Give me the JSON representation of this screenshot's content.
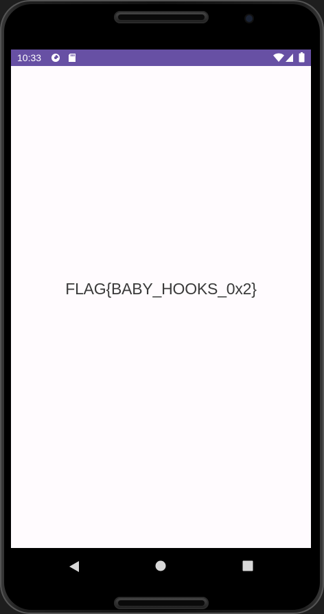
{
  "status_bar": {
    "time": "10:33",
    "background_color": "#6750a4",
    "left_icons": [
      "data-saver-icon",
      "sd-card-icon"
    ],
    "right_icons": [
      "wifi-icon",
      "cell-signal-icon",
      "battery-icon"
    ]
  },
  "main": {
    "message": "FLAG{BABY_HOOKS_0x2}",
    "background_color": "#fffbfe"
  },
  "nav_bar": {
    "buttons": [
      "back-icon",
      "home-icon",
      "recents-icon"
    ]
  }
}
